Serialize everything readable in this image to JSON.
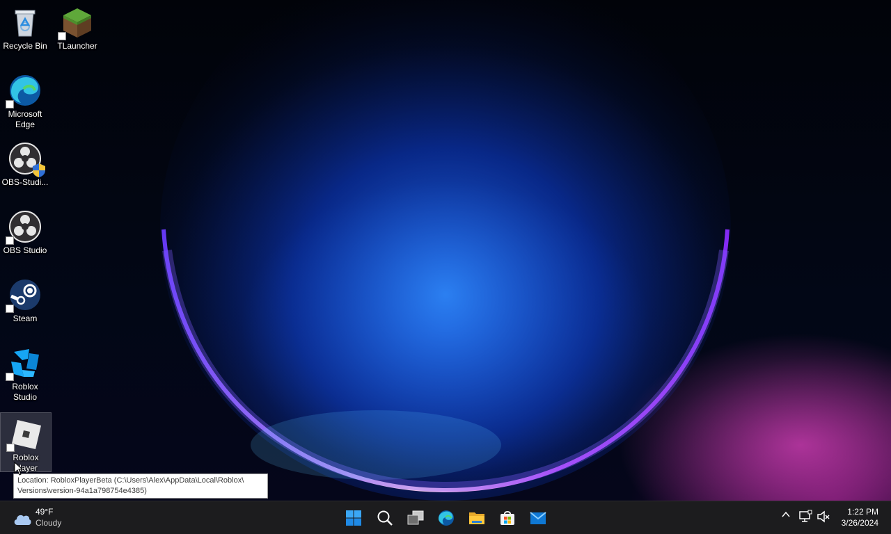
{
  "desktop": {
    "icons": [
      {
        "label": "Recycle Bin",
        "icon": "recycle-bin-icon"
      },
      {
        "label": "TLauncher",
        "icon": "tlauncher-icon"
      },
      {
        "label": "Microsoft Edge",
        "icon": "edge-icon"
      },
      {
        "label": "OBS-Studi...",
        "icon": "obs-icon"
      },
      {
        "label": "OBS Studio",
        "icon": "obs-icon"
      },
      {
        "label": "Steam",
        "icon": "steam-icon"
      },
      {
        "label": "Roblox Studio",
        "icon": "roblox-studio-icon"
      },
      {
        "label": "Roblox Player",
        "icon": "roblox-player-icon"
      }
    ],
    "tooltip": {
      "line1": "Location: RobloxPlayerBeta (C:\\Users\\Alex\\AppData\\Local\\Roblox\\",
      "line2": "Versions\\version-94a1a798754e4385)"
    }
  },
  "taskbar": {
    "weather": {
      "temp": "49°F",
      "condition": "Cloudy",
      "icon": "cloud-icon"
    },
    "apps": [
      {
        "name": "Start",
        "icon": "windows-start-icon"
      },
      {
        "name": "Search",
        "icon": "search-icon"
      },
      {
        "name": "Task View",
        "icon": "task-view-icon"
      },
      {
        "name": "Microsoft Edge",
        "icon": "edge-icon"
      },
      {
        "name": "File Explorer",
        "icon": "folder-icon"
      },
      {
        "name": "Microsoft Store",
        "icon": "store-icon"
      },
      {
        "name": "Mail",
        "icon": "mail-icon"
      }
    ],
    "clock": {
      "time": "1:22 PM",
      "date": "3/26/2024"
    }
  },
  "colors": {
    "taskbar_bg": "#1c1c1e",
    "accent_blue": "#0078d4",
    "tooltip_bg": "#ffffff"
  }
}
